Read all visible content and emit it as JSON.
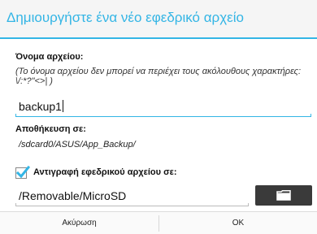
{
  "dialog": {
    "title": "Δημιουργήστε ένα νέο εφεδρικό αρχείο",
    "filename_label": "Όνομα αρχείου:",
    "filename_hint": "(Το όνομα αρχείου δεν μπορεί να περιέχει τους ακόλουθους χαρακτήρες: \\/:*?\"<>| )",
    "filename_value": "backup1",
    "save_to_label": "Αποθήκευση σε:",
    "save_to_path": "/sdcard0/ASUS/App_Backup/",
    "copy_checkbox_label": "Αντιγραφή εφεδρικού αρχείου σε:",
    "copy_checked": true,
    "copy_path_value": "/Removable/MicroSD",
    "folder_button_icon": "folder-icon",
    "cancel_label": "Ακύρωση",
    "ok_label": "OK"
  },
  "colors": {
    "accent": "#33b5e5",
    "folder_button": "#3a3a3a",
    "title_background": "#f5f5f5"
  }
}
